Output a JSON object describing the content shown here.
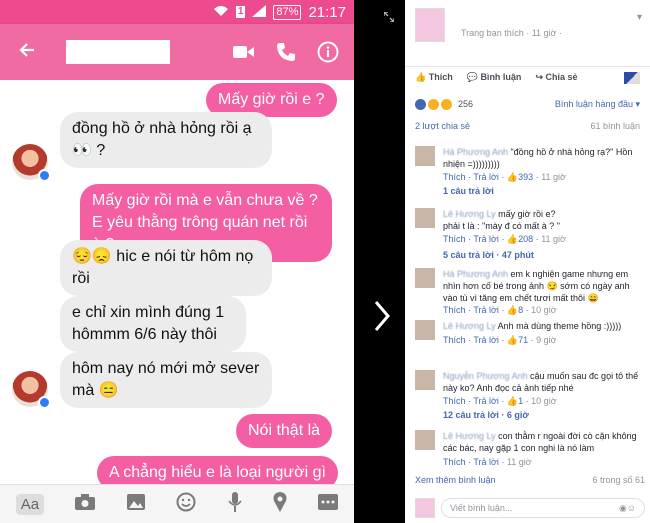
{
  "status_bar": {
    "sim": "1",
    "battery": "87%",
    "time": "21:17"
  },
  "colors": {
    "messenger_pink": "#f06ba2",
    "bubble_out": "#f45fa3",
    "bubble_in": "#ececec",
    "fb_link": "#4267b2"
  },
  "messenger": {
    "back_icon": "arrow-left-icon",
    "actions": [
      "video-camera-icon",
      "phone-icon",
      "info-icon"
    ],
    "messages": [
      {
        "side": "out",
        "text": "Mấy giờ rồi e ?"
      },
      {
        "side": "in",
        "text": "đồng hồ ở nhà hỏng rồi ạ 👀 ?"
      },
      {
        "side": "out",
        "text": "Mấy giờ rồi mà e vẫn chưa về ? E yêu thằng trông quán net rồi à ?"
      },
      {
        "side": "in",
        "text": "😔😞 hic e nói từ hôm nọ rồi"
      },
      {
        "side": "in",
        "text": "e chỉ xin mình đúng 1 hômmm 6/6 này thôi"
      },
      {
        "side": "in",
        "text": "hôm nay nó mới mở sever mà 😑"
      },
      {
        "side": "out",
        "text": "Nói thật là"
      },
      {
        "side": "out",
        "text": "A chẳng hiểu e là loại người gì"
      }
    ],
    "composer": {
      "aa_label": "Aa",
      "icons": [
        "camera-icon",
        "gallery-icon",
        "emoji-icon",
        "microphone-icon",
        "location-icon",
        "more-icon"
      ]
    }
  },
  "facebook": {
    "post_meta": "Trang bạn thích · 11 giờ ·",
    "actions": {
      "like": "Thích",
      "comment": "Bình luận",
      "share": "Chia sẻ"
    },
    "reactions_count": "256",
    "sort_label": "Bình luận hàng đầu ▾",
    "shares": "2 lượt chia sẻ",
    "comments_count": "61 bình luận",
    "comments": [
      {
        "name": "Hà Phương Anh",
        "text": "\"đồng hồ ở nhà hỏng rạ?\" Hồn nhiện =)))))))))",
        "like": "Thích",
        "reply": "Trả lời",
        "likes": "393",
        "time": "11 giờ",
        "replies": "1 câu trả lời"
      },
      {
        "name": "Lê Hương Ly",
        "text": "mấy giờ rồi e?\nphải t là : \"mày đ        có mất à ? \"",
        "like": "Thích",
        "reply": "Trả lời",
        "likes": "208",
        "time": "11 giờ",
        "replies": "5 câu trả lời · 47 phút"
      },
      {
        "name": "Hà Phương Anh",
        "text": "em k nghiện game nhưng em nhìn hơn cố bé trong ảnh 😏 sớm có ngày anh vào tù vì tăng em chết tươi mất thôi 😄",
        "like": "Thích",
        "reply": "Trả lời",
        "likes": "8",
        "time": "10 giờ"
      },
      {
        "name": "Lê Hương Ly",
        "text": "Anh          mà dùng theme hồng :)))))",
        "like": "Thích",
        "reply": "Trả lời",
        "likes": "71",
        "time": "9 giờ"
      },
      {
        "name": "Nguyễn Phương Anh",
        "text": "cậu muốn sau đc gọi tô thế này ko? Anh đọc cả ảnh tiếp nhé",
        "like": "Thích",
        "reply": "Trả lời",
        "likes": "1",
        "time": "10 giờ",
        "replies": "12 câu trả lời · 6 giờ"
      },
      {
        "name": "Lê Hương Ly",
        "text": "con thằm r   ngoài đời cò cặn không các bác, nay gặp 1 con nghi là nó làm",
        "like": "Thích",
        "reply": "Trả lời",
        "time": "11 giờ"
      }
    ],
    "more_comments": "Xem thêm bình luận",
    "comments_progress": "6 trong số 61",
    "write_placeholder": "Viết bình luận..."
  }
}
